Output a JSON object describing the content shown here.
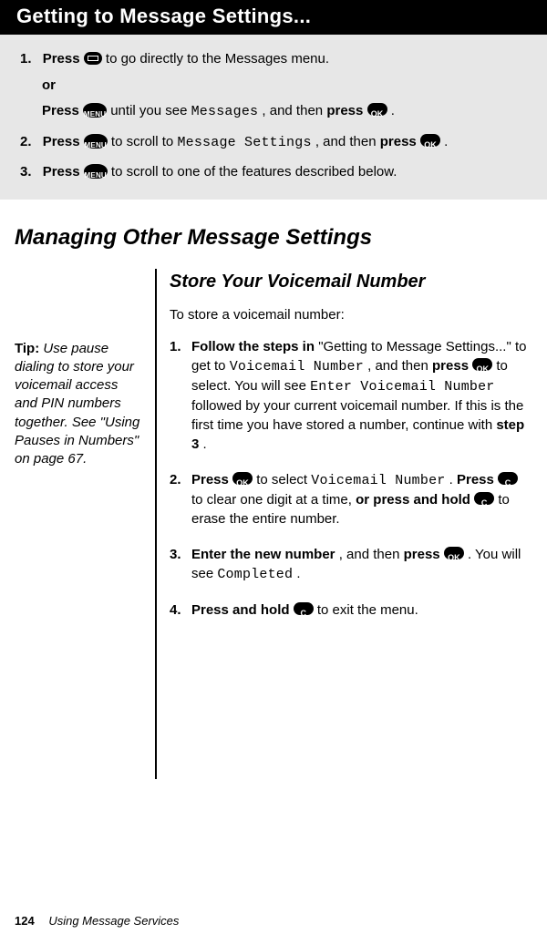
{
  "titlebar": "Getting to Message Settings...",
  "grey_steps": {
    "s1a_prefix": "Press ",
    "s1a_suffix": " to go directly to the Messages menu.",
    "or": "or",
    "s1b_prefix": "Press ",
    "s1b_mid1": " until you see ",
    "s1b_lcd": "Messages",
    "s1b_mid2": ", and then ",
    "s1b_bold": "press ",
    "s1b_suffix": ".",
    "s2_prefix": "Press ",
    "s2_mid1": " to scroll to ",
    "s2_lcd": "Message Settings",
    "s2_mid2": ", and then ",
    "s2_bold": "press ",
    "s2_suffix": ".",
    "s3_prefix": "Press ",
    "s3_suffix": " to scroll to one of the features described below."
  },
  "h1": "Managing Other Message Settings",
  "tip": {
    "label": "Tip: ",
    "body": "Use pause dialing to store your voicemail access and PIN numbers together. See \"Using Pauses in Numbers\" on page 67."
  },
  "h2": "Store Your Voicemail Number",
  "intro": "To store a voicemail number:",
  "body_steps": {
    "s1": {
      "bold1": "Follow the steps in ",
      "q": "\"Getting to Message Settings...\" to get to ",
      "lcd1": "Voicemail Number",
      "mid1": ", and then ",
      "bold2": "press ",
      "mid2": " to select. You will see ",
      "lcd2": "Enter Voicemail Number",
      "mid3": " followed by your current voicemail number. If this is the first time you have stored a number, continue with ",
      "bold3": "step 3",
      "end": "."
    },
    "s2": {
      "bold1": "Press ",
      "mid1": " to select ",
      "lcd1": "Voicemail Number",
      "end1": ". ",
      "bold2": "Press ",
      "mid2": " to clear one digit at a time, ",
      "bold3": "or press and hold ",
      "mid3": " to erase the entire number."
    },
    "s3": {
      "bold1": "Enter the new number",
      "mid1": ", and then ",
      "bold2": "press ",
      "mid2": ". You will see ",
      "lcd1": "Completed",
      "end": "."
    },
    "s4": {
      "bold1": "Press and hold ",
      "mid1": " to exit the menu."
    }
  },
  "footer": {
    "page_number": "124",
    "chapter": "Using Message Services"
  },
  "icon_labels": {
    "menu": "MENU",
    "ok": "OK",
    "c": "C"
  }
}
